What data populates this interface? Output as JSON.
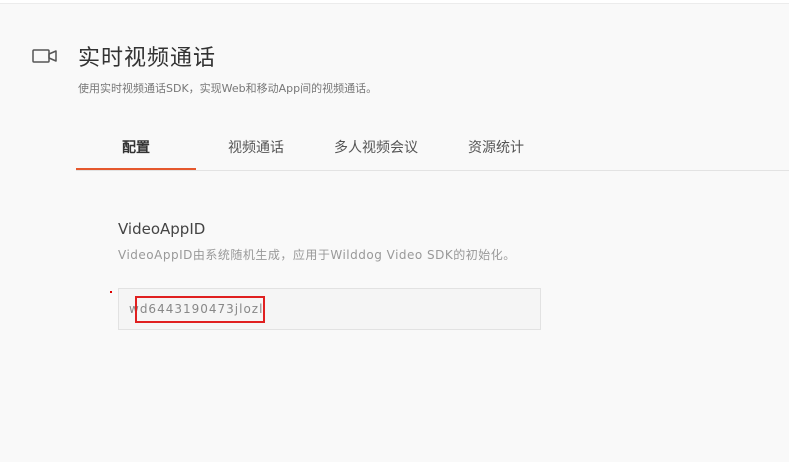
{
  "header": {
    "icon": "video-camera-icon",
    "title": "实时视频通话",
    "subtitle": "使用实时视频通话SDK，实现Web和移动App间的视频通话。"
  },
  "tabs": [
    {
      "label": "配置",
      "active": true
    },
    {
      "label": "视频通话",
      "active": false
    },
    {
      "label": "多人视频会议",
      "active": false
    },
    {
      "label": "资源统计",
      "active": false
    }
  ],
  "config": {
    "title": "VideoAppID",
    "description": "VideoAppID由系统随机生成，应用于Wilddog Video SDK的初始化。",
    "value": "wd6443190473jlozl"
  },
  "colors": {
    "accent": "#e5582d",
    "highlight": "#e02020"
  }
}
